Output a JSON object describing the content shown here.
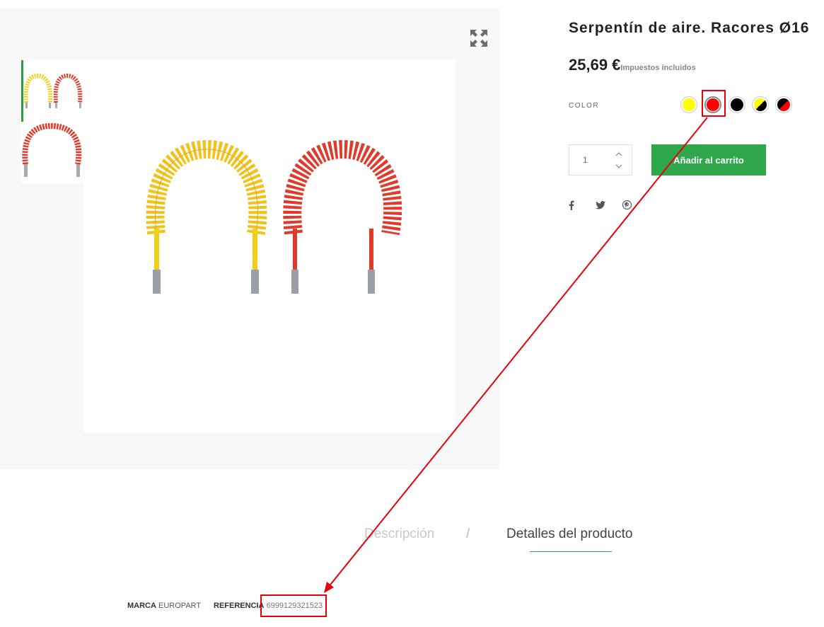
{
  "product": {
    "title": "Serpentín de aire. Racores Ø16",
    "price": "25,69 €",
    "tax_note": "Impuestos incluidos"
  },
  "gallery": {
    "expand_icon": "expand-icon",
    "thumbnails": [
      "thumbnail-yellow-red-coils",
      "thumbnail-red-coil"
    ],
    "active_thumbnail": 0
  },
  "options": {
    "color_label": "COLOR",
    "swatches": [
      {
        "name": "yellow",
        "colors": [
          "#ffff00"
        ]
      },
      {
        "name": "red",
        "colors": [
          "#ff0000"
        ],
        "selected": true
      },
      {
        "name": "black",
        "colors": [
          "#000000"
        ]
      },
      {
        "name": "yellow-black",
        "colors": [
          "#ffff00",
          "#000000"
        ]
      },
      {
        "name": "black-red",
        "colors": [
          "#000000",
          "#ff0000"
        ]
      }
    ]
  },
  "cart": {
    "quantity": "1",
    "add_label": "Añadir al carrito",
    "accent": "#2ea84a"
  },
  "social": [
    "facebook-icon",
    "twitter-icon",
    "pinterest-icon"
  ],
  "tabs": {
    "description": "Descripción",
    "separator": "/",
    "details": "Detalles del producto",
    "active": "details"
  },
  "details": {
    "brand_label": "MARCA",
    "brand_value": "EUROPART",
    "reference_label": "REFERENCIA",
    "reference_value": "6999129321523"
  },
  "annotation": {
    "color": "#e8000b"
  }
}
